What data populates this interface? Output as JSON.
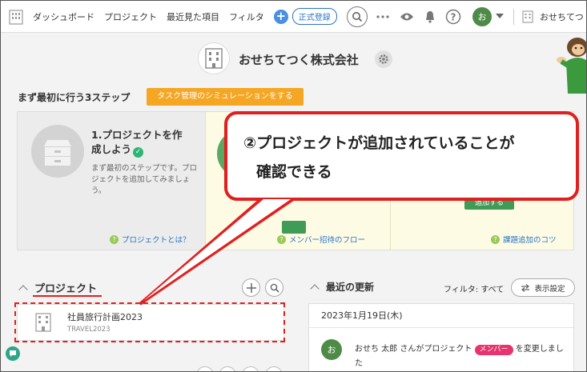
{
  "nav": {
    "items": [
      "ダッシュボード",
      "プロジェクト",
      "最近見た項目",
      "フィルタ"
    ],
    "register_label": "正式登録",
    "avatar_initial": "お",
    "company_short": "おせちてつ"
  },
  "company": {
    "name": "おせちてつく株式会社"
  },
  "steps": {
    "title": "まず最初に行う3ステップ",
    "simulation_button": "タスク管理のシミュレーションをする",
    "step1": {
      "title_line1": "1.プロジェクトを作",
      "title_line2": "成しよう",
      "desc": "まず最初のステップです。プロジェクトを追加してみましょう。",
      "link": "プロジェクトとは？"
    },
    "step2": {
      "link": "メンバー招待のフロー"
    },
    "step3": {
      "button": "追加する",
      "link": "課題追加のコツ"
    }
  },
  "projects": {
    "title": "プロジェクト",
    "items": [
      {
        "name": "社員旅行計画2023",
        "key": "TRAVEL2023"
      }
    ]
  },
  "recent": {
    "title": "最近の更新",
    "filter_label": "フィルタ: すべて",
    "display_settings": "表示設定",
    "date": "2023年1月19日(木)",
    "update": {
      "avatar_initial": "お",
      "text_before": "おせち 太郎 さんがプロジェクト",
      "badge": "メンバー",
      "text_after": "を変更しました"
    }
  },
  "callout": {
    "line1": "②プロジェクトが追加されていることが",
    "line2": "確認できる"
  },
  "colors": {
    "accent_orange": "#f5a623",
    "annotation_red": "#e02020",
    "avatar_green": "#4e8b47",
    "badge_pink": "#e8336d",
    "link_blue": "#2a73c5"
  }
}
